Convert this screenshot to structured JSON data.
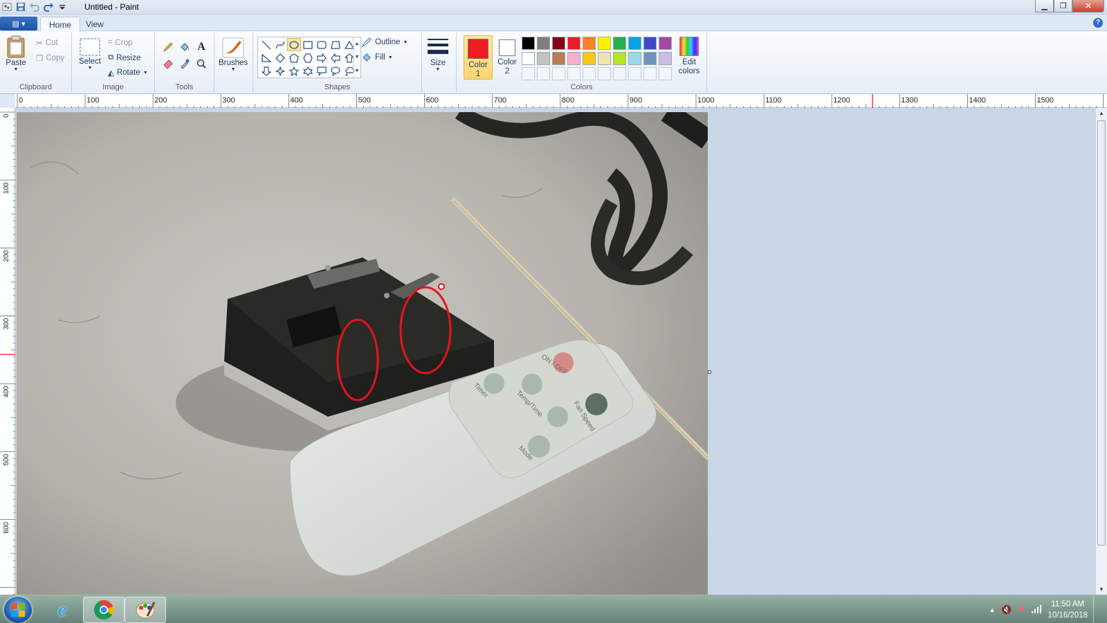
{
  "window": {
    "title": "Untitled - Paint",
    "qat_icons": [
      "paint-app-icon",
      "save-icon",
      "undo-icon",
      "redo-icon",
      "customize-qat-icon"
    ]
  },
  "tabs": [
    "Home",
    "View"
  ],
  "clipboard": {
    "label": "Clipboard",
    "paste": "Paste",
    "cut": "Cut",
    "copy": "Copy"
  },
  "image": {
    "label": "Image",
    "select": "Select",
    "crop": "Crop",
    "resize": "Resize",
    "rotate": "Rotate"
  },
  "tools": {
    "label": "Tools"
  },
  "brushes": {
    "label": "Brushes"
  },
  "shapes": {
    "label": "Shapes",
    "outline": "Outline",
    "fill": "Fill"
  },
  "size": {
    "label": "Size"
  },
  "colors": {
    "label": "Colors",
    "color1_label": "Color 1",
    "color2_label": "Color 2",
    "color1": "#ed1c24",
    "color2": "#ffffff",
    "edit_colors": "Edit colors",
    "palette_row1": [
      "#000000",
      "#7f7f7f",
      "#880015",
      "#ed1c24",
      "#ff7f27",
      "#fff200",
      "#22b14c",
      "#00a2e8",
      "#3f48cc",
      "#a349a4"
    ],
    "palette_row2": [
      "#ffffff",
      "#c3c3c3",
      "#b97a57",
      "#ffaec9",
      "#ffc90e",
      "#efe4b0",
      "#b5e61d",
      "#99d9ea",
      "#7092be",
      "#c8bfe7"
    ]
  },
  "ruler": {
    "h": [
      "0",
      "100",
      "200",
      "300",
      "400",
      "500",
      "600",
      "700",
      "800",
      "900",
      "1000",
      "1100",
      "1200",
      "1300",
      "1400",
      "1500"
    ],
    "v": [
      "0",
      "100",
      "200",
      "300",
      "400",
      "500",
      "600"
    ]
  },
  "canvas_photo": {
    "remote_labels": [
      "ON / OFF",
      "Timer",
      "Temp/Time",
      "Fan Speed",
      "Mode"
    ]
  },
  "taskbar": {
    "apps": [
      "internet-explorer-icon",
      "chrome-icon",
      "paint-icon"
    ],
    "time": "11:50 AM",
    "date": "10/16/2018"
  }
}
